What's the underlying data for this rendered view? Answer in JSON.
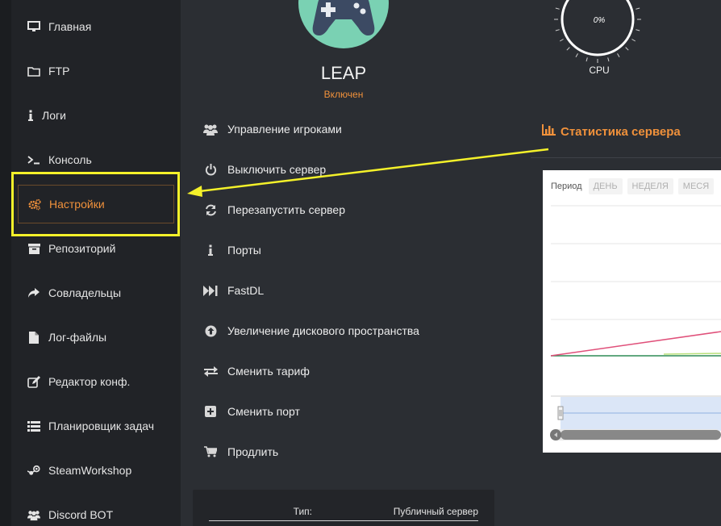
{
  "sidebar": {
    "items": [
      {
        "label": "Главная",
        "icon": "monitor-icon"
      },
      {
        "label": "FTP",
        "icon": "folder-icon"
      },
      {
        "label": "Логи",
        "icon": "info-icon"
      },
      {
        "label": "Консоль",
        "icon": "terminal-icon"
      },
      {
        "label": "Настройки",
        "icon": "cogs-icon",
        "active": true
      },
      {
        "label": "Репозиторий",
        "icon": "archive-icon"
      },
      {
        "label": "Совладельцы",
        "icon": "share-icon"
      },
      {
        "label": "Лог-файлы",
        "icon": "file-icon"
      },
      {
        "label": "Редактор конф.",
        "icon": "edit-icon"
      },
      {
        "label": "Планировщик задач",
        "icon": "list-icon"
      },
      {
        "label": "SteamWorkshop",
        "icon": "steam-icon"
      },
      {
        "label": "Discord BOT",
        "icon": "users-icon"
      }
    ]
  },
  "server": {
    "name": "LEAP",
    "status": "Включен",
    "avatar_icon": "gamepad-icon"
  },
  "actions": [
    {
      "label": "Управление игроками",
      "icon": "users-icon"
    },
    {
      "label": "Выключить сервер",
      "icon": "power-icon"
    },
    {
      "label": "Перезапустить сервер",
      "icon": "refresh-icon"
    },
    {
      "label": "Порты",
      "icon": "info-icon"
    },
    {
      "label": "FastDL",
      "icon": "fast-forward-icon"
    },
    {
      "label": "Увеличение дискового пространства",
      "icon": "upload-circle-icon"
    },
    {
      "label": "Сменить тариф",
      "icon": "exchange-icon"
    },
    {
      "label": "Сменить порт",
      "icon": "plus-square-icon"
    },
    {
      "label": "Продлить",
      "icon": "cart-icon"
    }
  ],
  "cpu": {
    "value": "0%",
    "label": "CPU"
  },
  "stats": {
    "title": "Статистика сервера",
    "period_label": "Период",
    "periods": [
      "ДЕНЬ",
      "НЕДЕЛЯ",
      "МЕСЯ"
    ]
  },
  "info": {
    "type_key": "Тип:",
    "type_value": "Публичный сервер"
  },
  "colors": {
    "accent": "#f0913b",
    "highlight": "#f4f12a",
    "sidebar_bg": "#212327",
    "main_bg": "#2b2e33",
    "avatar_bg": "#7ad1b3"
  }
}
